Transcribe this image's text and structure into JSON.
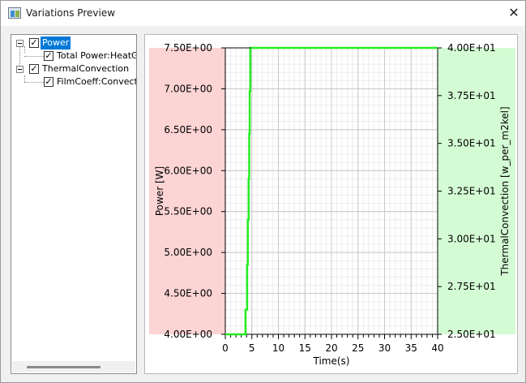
{
  "window": {
    "title": "Variations Preview",
    "close_glyph": "✕",
    "icon": "app-window-icon"
  },
  "tree": {
    "nodes": [
      {
        "label": "Power",
        "checked": true,
        "expanded": true,
        "selected": true,
        "children": [
          {
            "label": "Total Power:HeatGen",
            "checked": true
          }
        ]
      },
      {
        "label": "ThermalConvection",
        "checked": true,
        "expanded": true,
        "selected": false,
        "children": [
          {
            "label": "FilmCoeff:Convection",
            "checked": true
          }
        ]
      }
    ],
    "check_glyph": "✓"
  },
  "colors": {
    "left_axis_band": "#fcd4d4",
    "right_axis_band": "#d4fcd4",
    "series_line": "#22ee22",
    "grid_major": "#c8c8c8",
    "grid_minor": "#ececec",
    "selection": "#0078d7"
  },
  "chart_data": {
    "type": "line",
    "xlabel": "Time(s)",
    "ylabel_left": "Power [W]",
    "ylabel_right": "ThermalConvection [w_per_m2kel]",
    "xlim": [
      0,
      40
    ],
    "ylim_left": [
      4.0,
      7.5
    ],
    "ylim_right": [
      25.0,
      40.0
    ],
    "x_ticks": [
      "0",
      "5",
      "10",
      "15",
      "20",
      "25",
      "30",
      "35",
      "40"
    ],
    "y_ticks_left": [
      "4.00E+00",
      "4.50E+00",
      "5.00E+00",
      "5.50E+00",
      "6.00E+00",
      "6.50E+00",
      "7.00E+00",
      "7.50E+00"
    ],
    "y_ticks_right": [
      "2.50E+01",
      "2.75E+01",
      "3.00E+01",
      "3.25E+01",
      "3.50E+01",
      "3.75E+01",
      "4.00E+01"
    ],
    "grid": true,
    "series": [
      {
        "axis": "left",
        "x": [
          0,
          3.8,
          3.8,
          4.1,
          4.1,
          4.25,
          4.25,
          4.4,
          4.4,
          4.5,
          4.5,
          4.6,
          4.6,
          4.7,
          4.7,
          4.8,
          4.8,
          40
        ],
        "y": [
          4.0,
          4.0,
          4.3,
          4.3,
          4.85,
          4.85,
          5.4,
          5.4,
          5.9,
          5.9,
          6.45,
          6.45,
          6.97,
          6.97,
          7.5,
          7.5,
          7.5,
          7.5
        ]
      },
      {
        "axis": "left",
        "x": [
          0,
          4.8
        ],
        "y": [
          7.5,
          7.5
        ],
        "color": "#000000"
      }
    ]
  }
}
